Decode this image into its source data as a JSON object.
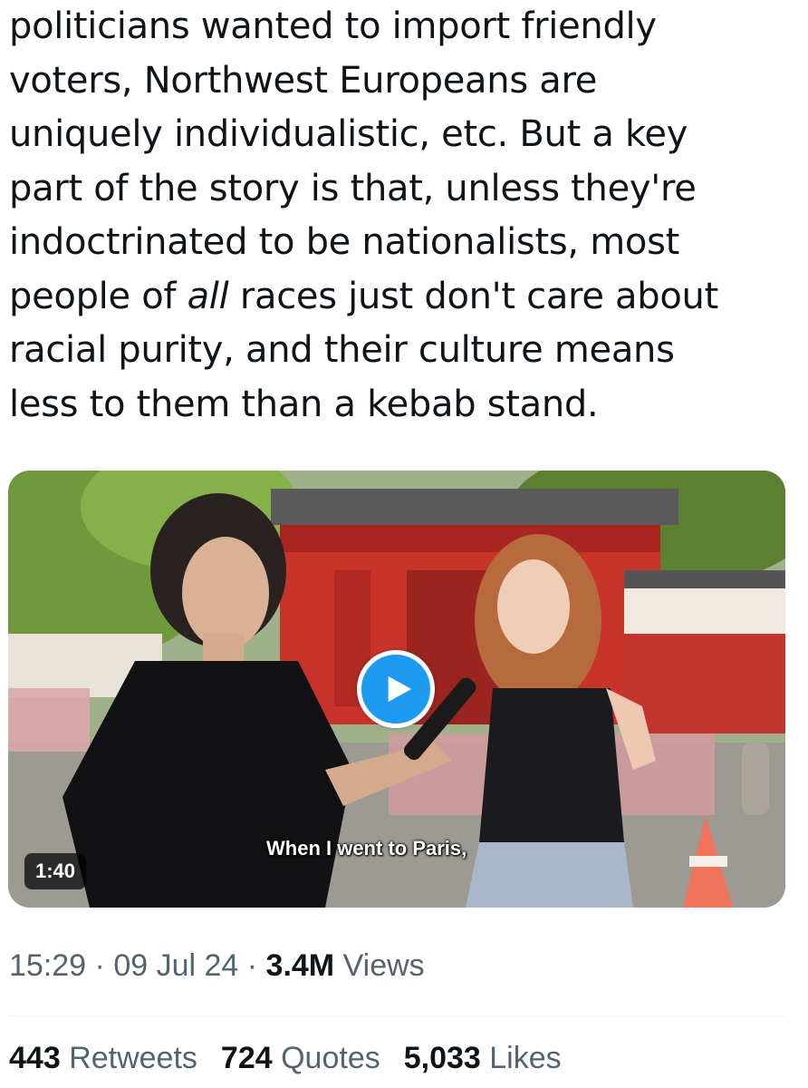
{
  "tweet": {
    "lines": [
      "politicians wanted to import friendly",
      "voters, Northwest Europeans are",
      "uniquely individualistic, etc. But a key",
      "part of the story is that, unless they're",
      "indoctrinated to be nationalists, most",
      "people of ",
      "all",
      " races just don't care about",
      "racial purity, and their culture means",
      "less to them than a kebab stand."
    ]
  },
  "video": {
    "duration": "1:40",
    "subtitle": "When I went to Paris,",
    "play_icon": "play-icon"
  },
  "meta": {
    "time": "15:29",
    "sep1": " · ",
    "date": "09 Jul 24",
    "sep2": " · ",
    "views_count": "3.4M",
    "views_label": " Views"
  },
  "stats": {
    "retweets_count": "443",
    "retweets_label": " Retweets",
    "quotes_count": "724",
    "quotes_label": " Quotes",
    "likes_count": "5,033",
    "likes_label": " Likes"
  },
  "colors": {
    "accent": "#1d9bf0",
    "text": "#0f1419",
    "secondary_text": "#536471"
  }
}
